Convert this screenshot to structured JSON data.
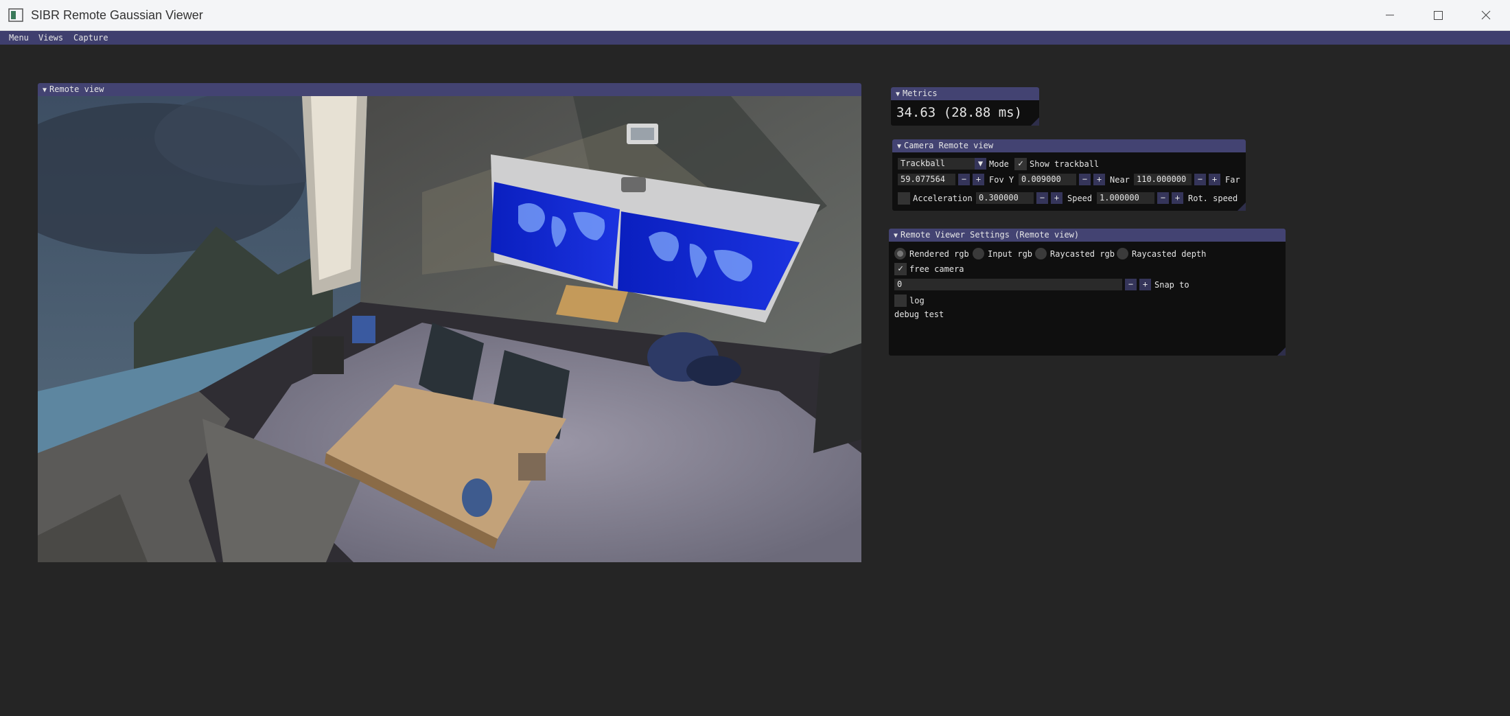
{
  "window": {
    "title": "SIBR Remote Gaussian Viewer"
  },
  "menubar": {
    "items": [
      "Menu",
      "Views",
      "Capture"
    ]
  },
  "remote_view": {
    "title": "Remote view"
  },
  "metrics": {
    "title": "Metrics",
    "value": "34.63 (28.88 ms)"
  },
  "camera": {
    "title": "Camera Remote view",
    "mode_value": "Trackball",
    "mode_label": "Mode",
    "show_trackball_label": "Show trackball",
    "show_trackball_checked": true,
    "fov_value": "59.077564",
    "fov_label": "Fov Y",
    "near_value": "0.009000",
    "near_label": "Near",
    "far_value": "110.000000",
    "far_label": "Far",
    "acceleration_label": "Acceleration",
    "acceleration_checked": false,
    "accel_value": "0.300000",
    "speed_label": "Speed",
    "speed_value": "1.000000",
    "rot_speed_label": "Rot. speed"
  },
  "settings": {
    "title": "Remote Viewer Settings (Remote view)",
    "radios": [
      "Rendered rgb",
      "Input rgb",
      "Raycasted rgb",
      "Raycasted depth"
    ],
    "selected_radio": "Rendered rgb",
    "free_camera_label": "free camera",
    "free_camera_checked": true,
    "snap_value": "0",
    "snap_label": "Snap to",
    "log_label": "log",
    "log_checked": false,
    "debug_text": "debug test"
  },
  "buttons": {
    "minus": "−",
    "plus": "+",
    "check": "✓"
  },
  "colors": {
    "titlebar": "#434372",
    "menubar": "#3f3f6e",
    "background": "#252525",
    "panel": "#0f0f0f"
  }
}
